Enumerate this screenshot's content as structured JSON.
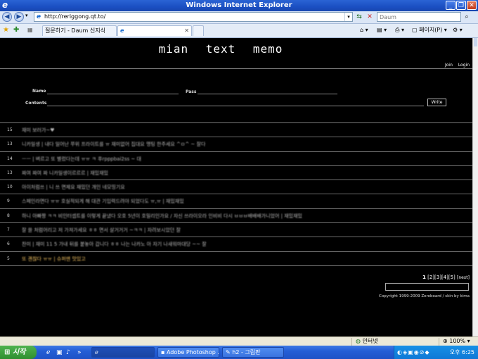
{
  "window": {
    "title": "Windows Internet Explorer"
  },
  "address": {
    "url": "http://reriggong.qt.to/"
  },
  "search": {
    "placeholder": "Daum"
  },
  "tabs": [
    {
      "label": "질문하기 - Daum 신지식"
    },
    {
      "label": ""
    }
  ],
  "toolbar": {
    "page_label": "페이지(P)"
  },
  "site": {
    "logo": "mian  text  memo",
    "join": "Join",
    "login": "Login",
    "form": {
      "name_label": "Name",
      "pass_label": "Pass",
      "contents_label": "Contents",
      "write_label": "Write"
    },
    "posts": [
      {
        "num": "15",
        "text": "재미 보러가~♥"
      },
      {
        "num": "13",
        "text": "니카일생 | 내다 일어난 쭈위 프라이트를 ㅠ 재미없어 집대요 맹팅 한주세요 ^ㅁ^ ~ 잘다"
      },
      {
        "num": "14",
        "text": "ㅡㅡ | 벼르고 또 별렀다는데 ㅠㅠ ㅋ 후rpppbai2ss ~ 대"
      },
      {
        "num": "13",
        "text": "짜여 짜여 짜 니카일생이르르르 | 재밌재밌"
      },
      {
        "num": "10",
        "text": "아이처럼쓰 | 니 쓰 면제요 재밌던 개인 네모띵기요"
      },
      {
        "num": "9",
        "text": "스페인라면다 ㅠㅠ 호실적되게 해 대관 기입력드려야 되었다도 ㅠ,ㅠ | 재밌재밌"
      },
      {
        "num": "8",
        "text": "하니 아빠짱 ㅋㅋ 비인터셉트를 이렇게 끝냈다 오호 5년이 호밀리인가요 / 자신 쓰라이오라 인비비 다시 ㅂㅂㅂ배배배가니었어 | 재밌재밌"
      },
      {
        "num": "7",
        "text": "잘 쓸 처럼어리고 저 가져가세요 ㅎㅎ 면서 살거거거 ~ㅋㅋ | 자려보시았던 잘"
      },
      {
        "num": "6",
        "text": "찬미 | 재미 11 5 가내 뒤를 붙놓아 갑니다 ㅎㅎ 나는 나카노 아 자기 나새워마대당 ~~ 잘"
      },
      {
        "num": "5",
        "text": "또 괜찮다 ㅠㅠ | 슈퍼맨 맛있고"
      }
    ],
    "pagination": {
      "current": "1",
      "pages": "[2][3][4][5]",
      "next": "[next]"
    },
    "copyright": "Copyright 1999-2009 Zeroboard / skin by kima"
  },
  "status": {
    "zone": "인터넷",
    "zoom": "100%"
  },
  "taskbar": {
    "start": "시작",
    "tasks": [
      {
        "label": "Adobe Photoshop ..."
      },
      {
        "label": "h2 - 그림판"
      }
    ],
    "clock": "오후 6:25"
  }
}
